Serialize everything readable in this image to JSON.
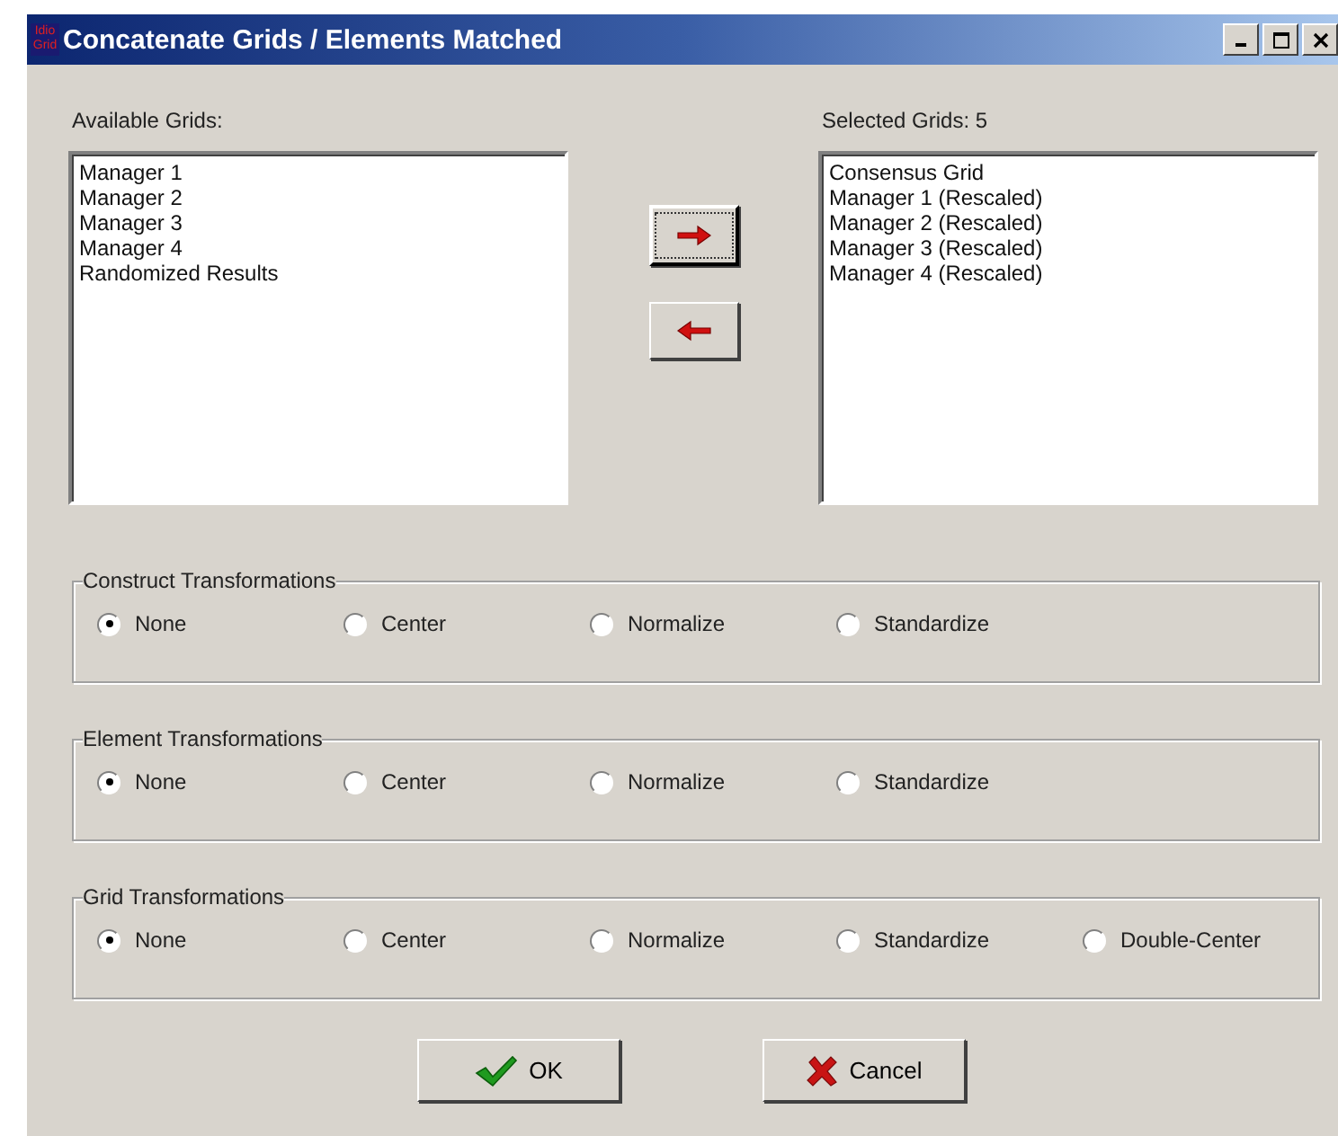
{
  "window": {
    "title": "Concatenate Grids / Elements Matched",
    "logo_text": "Idio Grid"
  },
  "available": {
    "label": "Available Grids:",
    "items": [
      {
        "text": "Manager 1"
      },
      {
        "text": "Manager 2"
      },
      {
        "text": "Manager 3"
      },
      {
        "text": "Manager 4"
      },
      {
        "text": "Randomized Results"
      }
    ]
  },
  "selected": {
    "label": "Selected Grids: 5",
    "items": [
      {
        "text": "Consensus Grid"
      },
      {
        "text": "Manager 1 (Rescaled)"
      },
      {
        "text": "Manager 2 (Rescaled)"
      },
      {
        "text": "Manager 3 (Rescaled)"
      },
      {
        "text": "Manager 4 (Rescaled)"
      }
    ]
  },
  "move_buttons": [
    {
      "kind": "right",
      "focused": true
    },
    {
      "kind": "left",
      "focused": false
    }
  ],
  "groups": [
    {
      "title": "Construct Transformations",
      "options": [
        {
          "label": "None",
          "selected": true
        },
        {
          "label": "Center",
          "selected": false
        },
        {
          "label": "Normalize",
          "selected": false
        },
        {
          "label": "Standardize",
          "selected": false
        }
      ]
    },
    {
      "title": "Element Transformations",
      "options": [
        {
          "label": "None",
          "selected": true
        },
        {
          "label": "Center",
          "selected": false
        },
        {
          "label": "Normalize",
          "selected": false
        },
        {
          "label": "Standardize",
          "selected": false
        }
      ]
    },
    {
      "title": "Grid Transformations",
      "options": [
        {
          "label": "None",
          "selected": true
        },
        {
          "label": "Center",
          "selected": false
        },
        {
          "label": "Normalize",
          "selected": false
        },
        {
          "label": "Standardize",
          "selected": false
        },
        {
          "label": "Double-Center",
          "selected": false
        }
      ]
    }
  ],
  "buttons": [
    {
      "kind": "ok",
      "label": "OK"
    },
    {
      "kind": "cancel",
      "label": "Cancel"
    }
  ]
}
